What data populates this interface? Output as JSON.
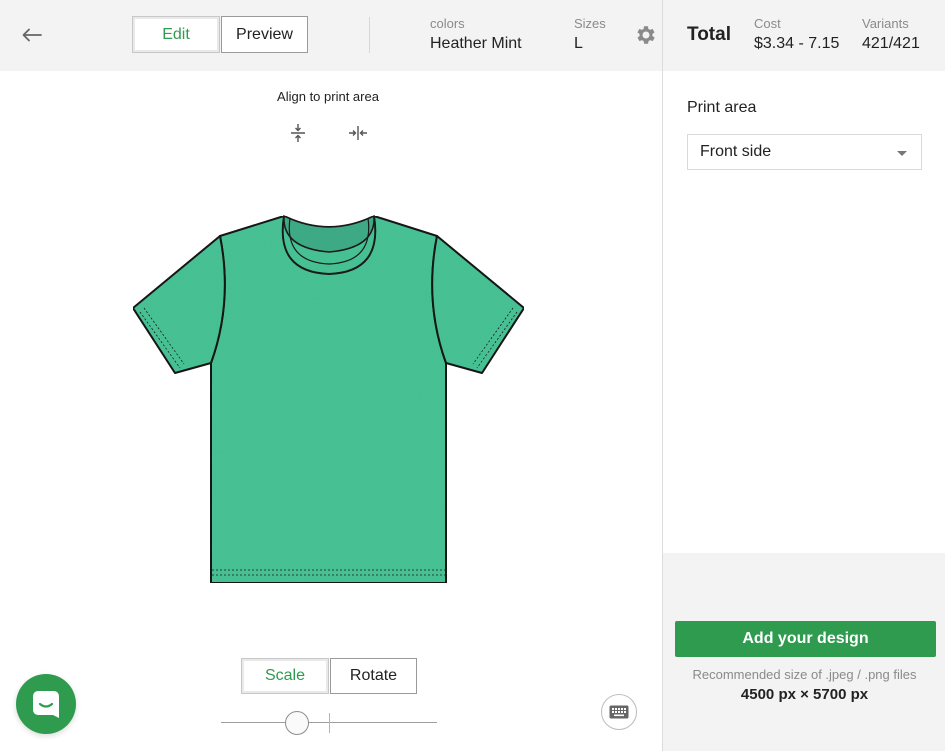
{
  "header": {
    "tabs": [
      {
        "label": "Edit",
        "active": true
      },
      {
        "label": "Preview",
        "active": false
      }
    ],
    "colors_label": "colors",
    "colors_value": "Heather Mint",
    "sizes_label": "Sizes",
    "sizes_value": "L",
    "icons": {
      "back": "arrow-left-icon",
      "settings": "gear-icon"
    }
  },
  "canvas": {
    "align_label": "Align to print area",
    "align_icons": [
      "align-vertical-center-icon",
      "align-horizontal-center-icon"
    ],
    "product_color": "#48c597",
    "transform_tabs": [
      {
        "label": "Scale",
        "active": true
      },
      {
        "label": "Rotate",
        "active": false
      }
    ],
    "scale_slider": {
      "value": 0.35
    }
  },
  "summary": {
    "total_label": "Total",
    "cost_label": "Cost",
    "cost_value": "$3.34 - 7.15",
    "variants_label": "Variants",
    "variants_value": "421/421"
  },
  "print_area": {
    "title": "Print area",
    "selected": "Front side"
  },
  "footer": {
    "add_button": "Add your design",
    "recommended_text": "Recommended size of .jpeg / .png files",
    "dimensions": "4500 px × 5700 px"
  },
  "colors": {
    "accent": "#2e9b4f",
    "bar_bg": "#f3f3f3"
  }
}
